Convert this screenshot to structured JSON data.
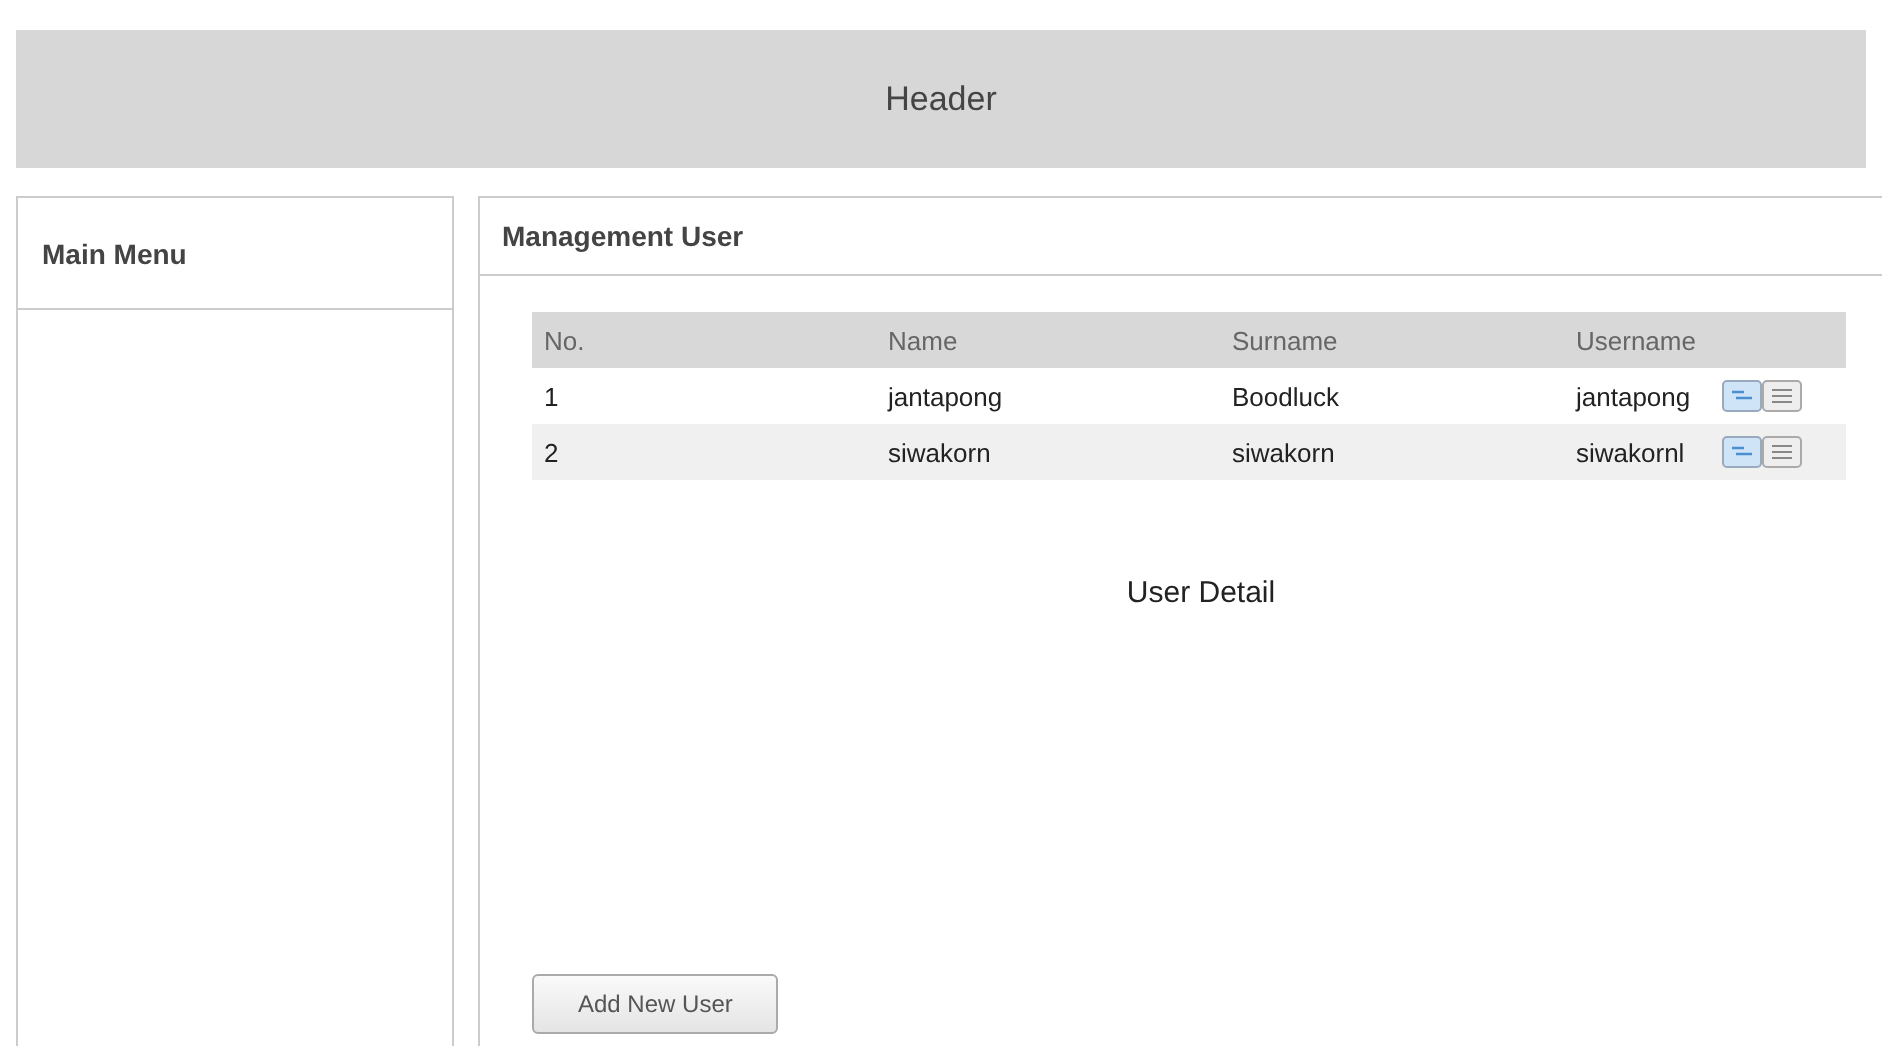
{
  "header": {
    "title": "Header"
  },
  "sidebar": {
    "title": "Main Menu"
  },
  "panel": {
    "title": "Management User",
    "table": {
      "columns": [
        "No.",
        "Name",
        "Surname",
        "Username"
      ],
      "rows": [
        {
          "cells": [
            "1",
            "jantapong",
            "Boodluck",
            "jantapong"
          ]
        },
        {
          "cells": [
            "2",
            "siwakorn",
            "siwakorn",
            "siwakornl"
          ]
        }
      ]
    },
    "detail_title": "User Detail",
    "add_button": "Add New User"
  }
}
